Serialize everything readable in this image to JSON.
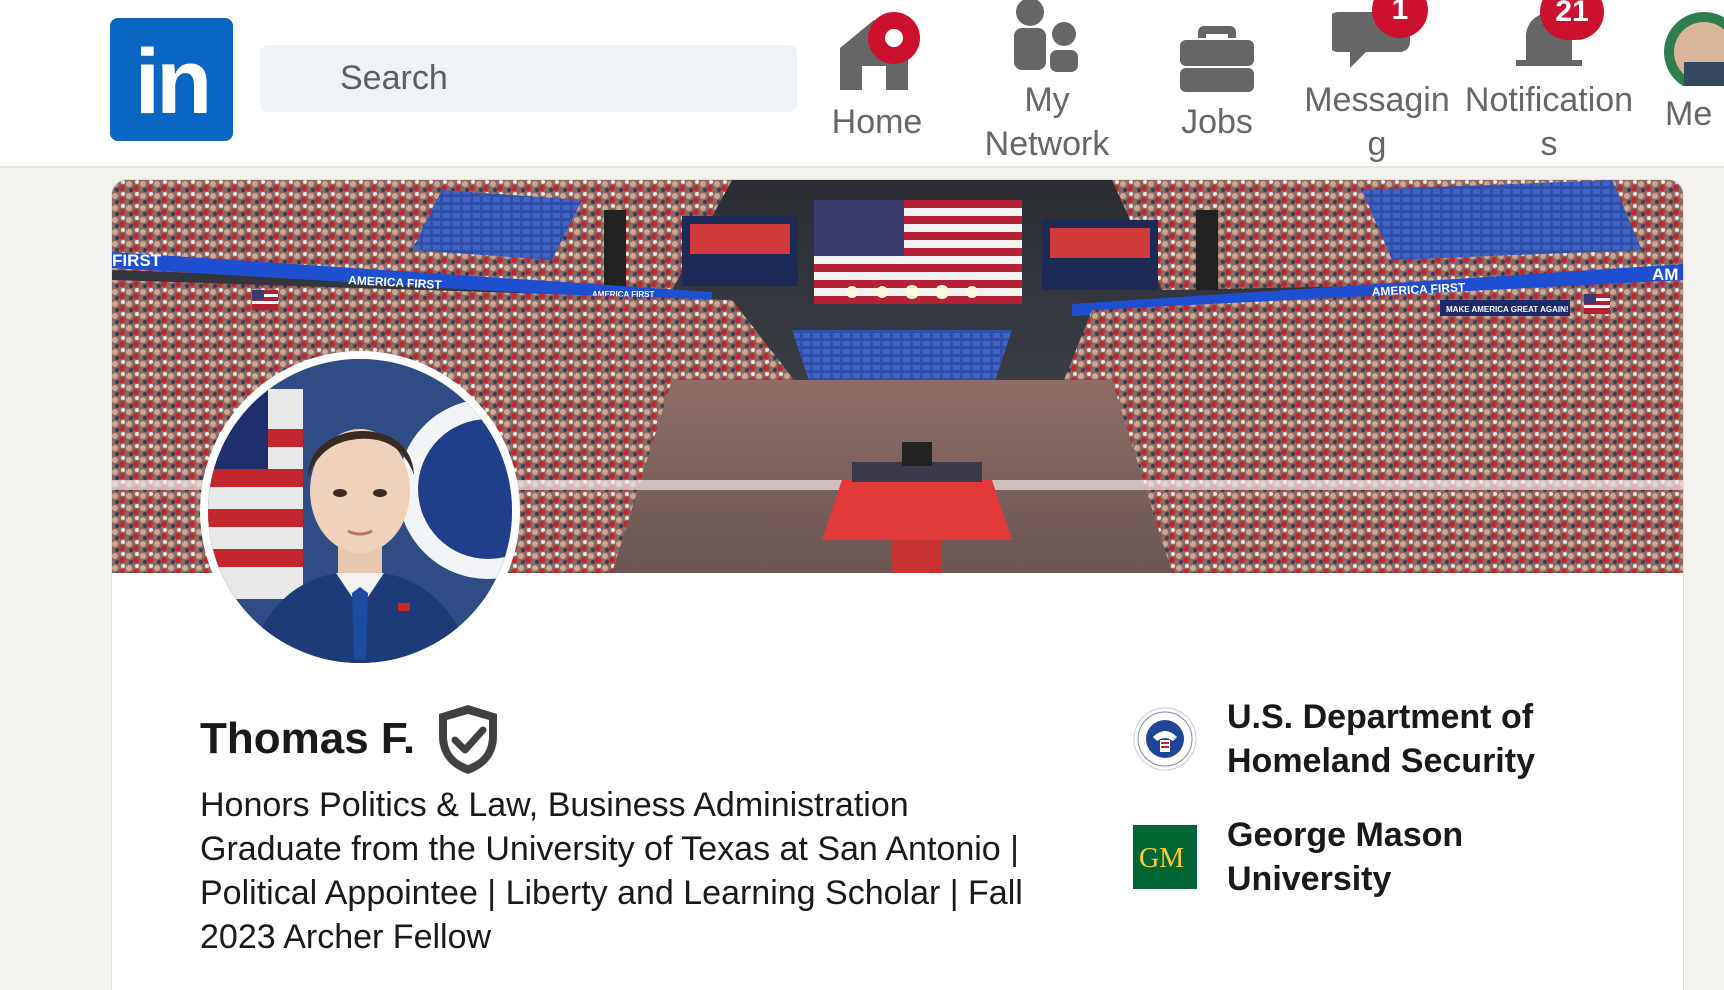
{
  "brand": {
    "logo_text": "in",
    "color": "#0a66c2"
  },
  "search": {
    "placeholder": "Search"
  },
  "nav": {
    "items": [
      {
        "label": "Home",
        "icon": "home-icon"
      },
      {
        "label": "My Network",
        "icon": "people-icon"
      },
      {
        "label": "Jobs",
        "icon": "briefcase-icon"
      },
      {
        "label": "Messaging",
        "icon": "chat-icon",
        "badge": "1"
      },
      {
        "label": "Notifications",
        "icon": "bell-icon",
        "badge": "21"
      },
      {
        "label": "Me",
        "icon": "avatar-icon"
      }
    ]
  },
  "cover": {
    "banner_left": "FIRST",
    "banner_1": "AMERICA FIRST",
    "banner_2": "AMERICA FIRST",
    "banner_3": "AMERICA FIRST",
    "banner_right": "AM",
    "sign": "MAKE AMERICA GREAT AGAIN!"
  },
  "profile": {
    "name": "Thomas F.",
    "verified_icon": "verified-shield-icon",
    "headline": "Honors Politics & Law, Business Administration Graduate from the University of Texas at San Antonio | Political Appointee | Liberty and Learning Scholar | Fall 2023 Archer Fellow"
  },
  "organizations": [
    {
      "name": "U.S. Department of Homeland Security",
      "logo": "dhs-seal-icon"
    },
    {
      "name": "George Mason University",
      "logo": "gmu-logo-icon",
      "logo_text": "GM"
    }
  ],
  "colors": {
    "badge": "#cb112d",
    "nav_text": "#666666",
    "gmu_green": "#006633",
    "gmu_gold": "#ffcc33"
  }
}
